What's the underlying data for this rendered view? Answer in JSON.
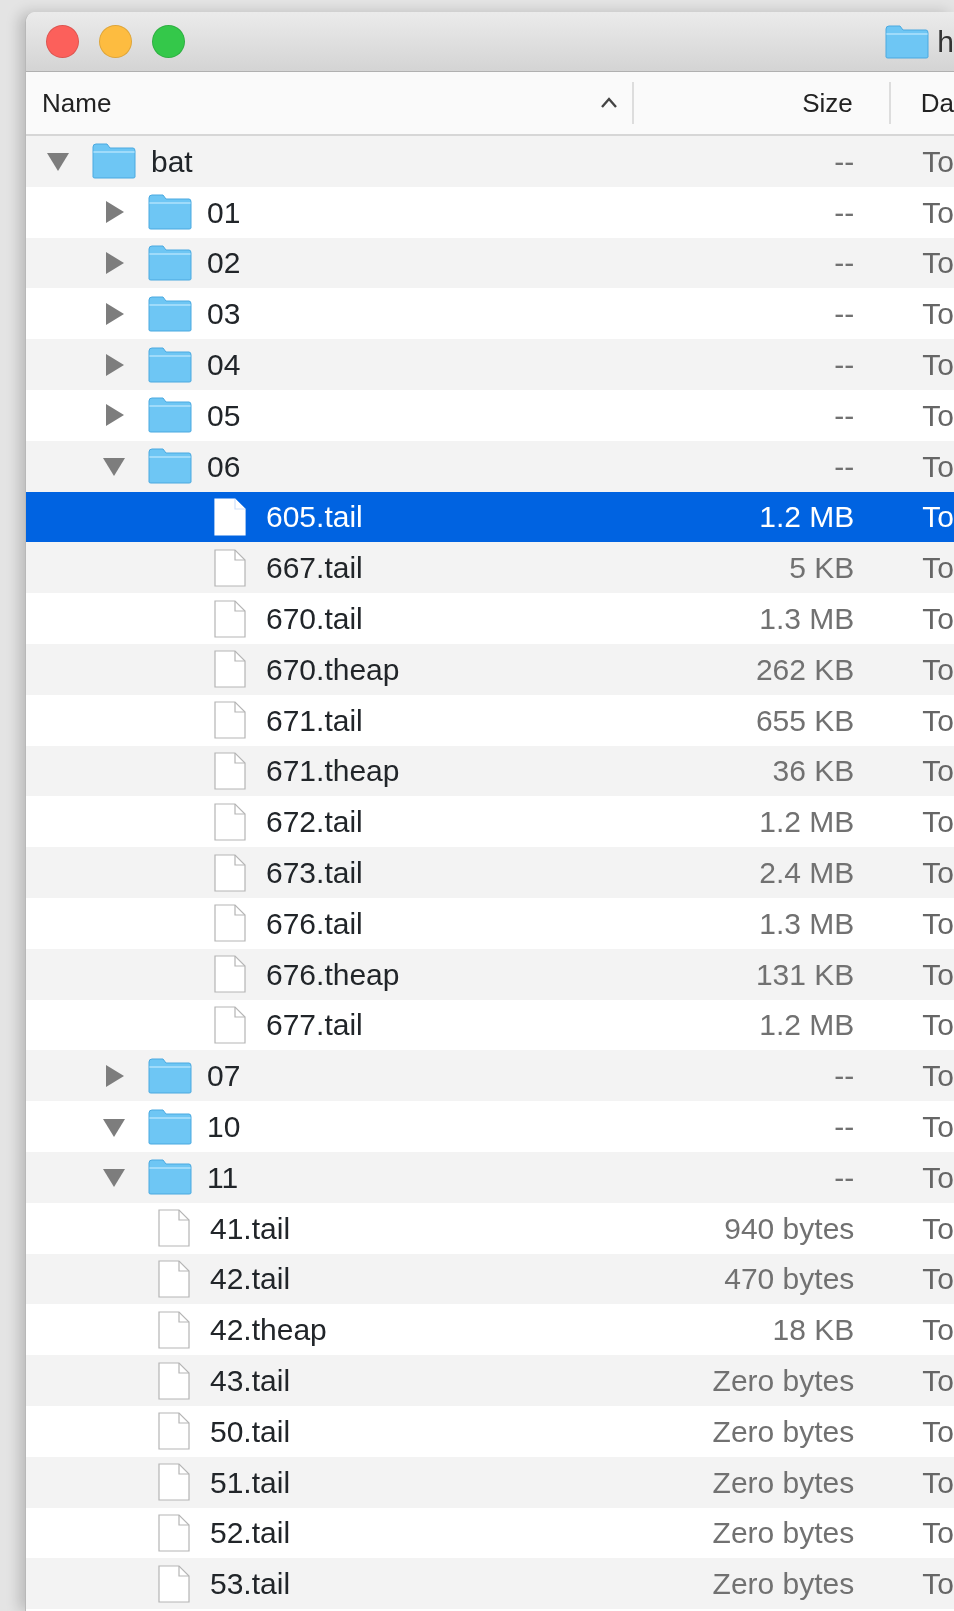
{
  "window": {
    "title": "h"
  },
  "columns": [
    {
      "label": "Name",
      "sorted_ascending": true
    },
    {
      "label": "Size"
    },
    {
      "label": "Da"
    }
  ],
  "tree": [
    {
      "name": "bat",
      "kind": "folder",
      "expanded": true,
      "selected": false,
      "size": "--",
      "date": "To",
      "children": [
        {
          "name": "01",
          "kind": "folder",
          "expanded": false,
          "selected": false,
          "size": "--",
          "date": "To"
        },
        {
          "name": "02",
          "kind": "folder",
          "expanded": false,
          "selected": false,
          "size": "--",
          "date": "To"
        },
        {
          "name": "03",
          "kind": "folder",
          "expanded": false,
          "selected": false,
          "size": "--",
          "date": "To"
        },
        {
          "name": "04",
          "kind": "folder",
          "expanded": false,
          "selected": false,
          "size": "--",
          "date": "To"
        },
        {
          "name": "05",
          "kind": "folder",
          "expanded": false,
          "selected": false,
          "size": "--",
          "date": "To"
        },
        {
          "name": "06",
          "kind": "folder",
          "expanded": true,
          "selected": false,
          "size": "--",
          "date": "To",
          "children": [
            {
              "name": "605.tail",
              "kind": "file",
              "selected": true,
              "size": "1.2 MB",
              "date": "To"
            },
            {
              "name": "667.tail",
              "kind": "file",
              "selected": false,
              "size": "5 KB",
              "date": "To"
            },
            {
              "name": "670.tail",
              "kind": "file",
              "selected": false,
              "size": "1.3 MB",
              "date": "To"
            },
            {
              "name": "670.theap",
              "kind": "file",
              "selected": false,
              "size": "262 KB",
              "date": "To"
            },
            {
              "name": "671.tail",
              "kind": "file",
              "selected": false,
              "size": "655 KB",
              "date": "To"
            },
            {
              "name": "671.theap",
              "kind": "file",
              "selected": false,
              "size": "36 KB",
              "date": "To"
            },
            {
              "name": "672.tail",
              "kind": "file",
              "selected": false,
              "size": "1.2 MB",
              "date": "To"
            },
            {
              "name": "673.tail",
              "kind": "file",
              "selected": false,
              "size": "2.4 MB",
              "date": "To"
            },
            {
              "name": "676.tail",
              "kind": "file",
              "selected": false,
              "size": "1.3 MB",
              "date": "To"
            },
            {
              "name": "676.theap",
              "kind": "file",
              "selected": false,
              "size": "131 KB",
              "date": "To"
            },
            {
              "name": "677.tail",
              "kind": "file",
              "selected": false,
              "size": "1.2 MB",
              "date": "To"
            }
          ]
        },
        {
          "name": "07",
          "kind": "folder",
          "expanded": false,
          "selected": false,
          "size": "--",
          "date": "To"
        },
        {
          "name": "10",
          "kind": "folder",
          "expanded": true,
          "selected": false,
          "size": "--",
          "date": "To"
        },
        {
          "name": "11",
          "kind": "folder",
          "expanded": true,
          "selected": false,
          "size": "--",
          "date": "To"
        },
        {
          "name": "41.tail",
          "kind": "file",
          "selected": false,
          "size": "940 bytes",
          "date": "To"
        },
        {
          "name": "42.tail",
          "kind": "file",
          "selected": false,
          "size": "470 bytes",
          "date": "To"
        },
        {
          "name": "42.theap",
          "kind": "file",
          "selected": false,
          "size": "18 KB",
          "date": "To"
        },
        {
          "name": "43.tail",
          "kind": "file",
          "selected": false,
          "size": "Zero bytes",
          "date": "To"
        },
        {
          "name": "50.tail",
          "kind": "file",
          "selected": false,
          "size": "Zero bytes",
          "date": "To"
        },
        {
          "name": "51.tail",
          "kind": "file",
          "selected": false,
          "size": "Zero bytes",
          "date": "To"
        },
        {
          "name": "52.tail",
          "kind": "file",
          "selected": false,
          "size": "Zero bytes",
          "date": "To"
        },
        {
          "name": "53.tail",
          "kind": "file",
          "selected": false,
          "size": "Zero bytes",
          "date": "To"
        }
      ]
    }
  ]
}
